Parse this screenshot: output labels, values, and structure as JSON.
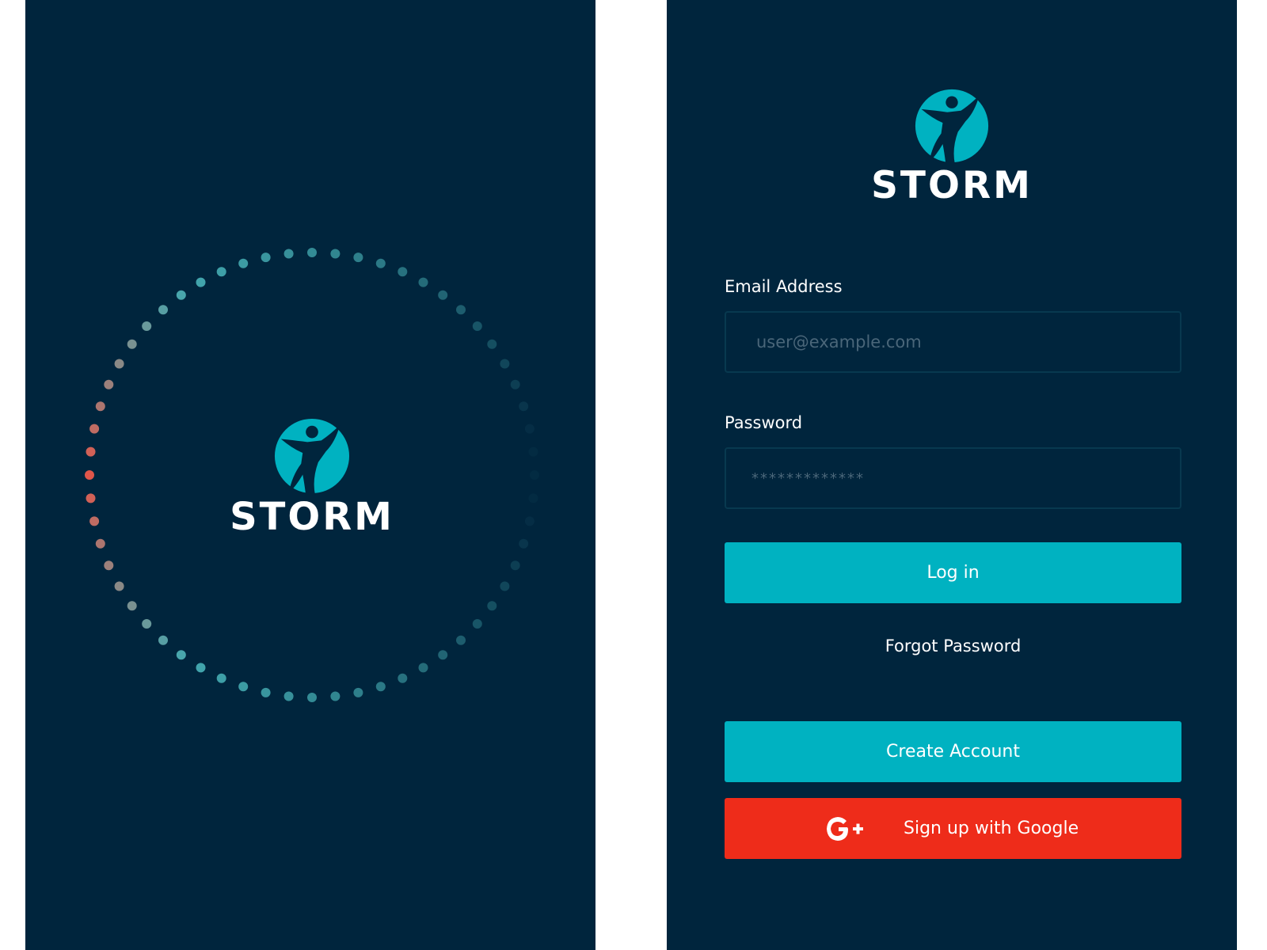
{
  "brand": {
    "name": "STORM",
    "primary_color": "#00b2c1",
    "background_color": "#00253d",
    "google_color": "#ee2c1a",
    "icon": "runner-logo-icon"
  },
  "splash": {
    "loader": {
      "icon": "loading-dots-spinner",
      "dot_count": 60,
      "accent_color": "#e0564a",
      "trail_color": "#4fc1c4"
    }
  },
  "login": {
    "email": {
      "label": "Email Address",
      "value": "",
      "placeholder": "user@example.com"
    },
    "password": {
      "label": "Password",
      "value": "",
      "placeholder": "*************"
    },
    "login_button": "Log in",
    "forgot_password": "Forgot Password",
    "create_account_button": "Create Account",
    "google_button": {
      "label": "Sign up with Google",
      "icon": "google-plus-icon"
    }
  }
}
